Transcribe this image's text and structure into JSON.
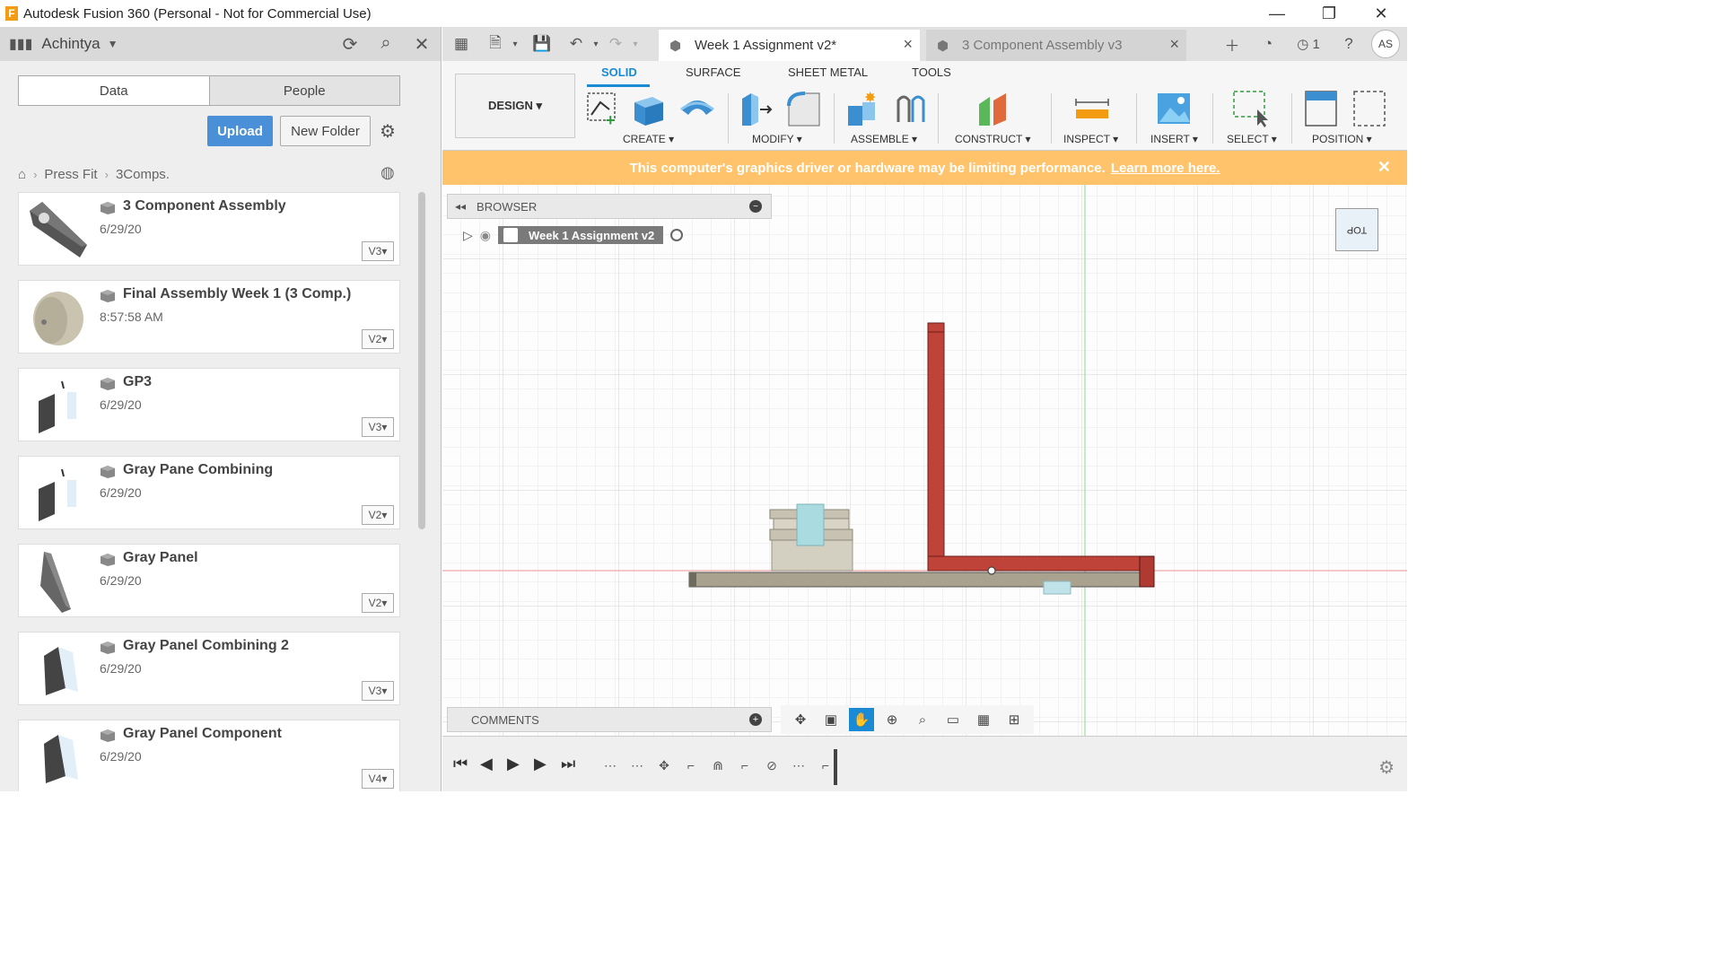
{
  "window": {
    "title": "Autodesk Fusion 360 (Personal - Not for Commercial Use)",
    "app_icon": "F",
    "controls": [
      "—",
      "❐",
      "✕"
    ]
  },
  "left_panel": {
    "user": "Achintya",
    "tabs": {
      "data": "Data",
      "people": "People"
    },
    "upload_label": "Upload",
    "new_folder_label": "New Folder",
    "breadcrumb": [
      "Press Fit",
      "3Comps."
    ],
    "files": [
      {
        "name": "3 Component Assembly",
        "date": "6/29/20",
        "version": "V3"
      },
      {
        "name": "Final Assembly Week 1 (3 Comp.)",
        "date": "8:57:58 AM",
        "version": "V2"
      },
      {
        "name": "GP3",
        "date": "6/29/20",
        "version": "V3"
      },
      {
        "name": "Gray Pane Combining",
        "date": "6/29/20",
        "version": "V2"
      },
      {
        "name": "Gray Panel",
        "date": "6/29/20",
        "version": "V2"
      },
      {
        "name": "Gray Panel Combining 2",
        "date": "6/29/20",
        "version": "V3"
      },
      {
        "name": "Gray Panel Component",
        "date": "6/29/20",
        "version": "V4"
      }
    ]
  },
  "doc_tabs": [
    {
      "label": "Week 1 Assignment v2*",
      "active": true
    },
    {
      "label": "3 Component Assembly v3",
      "active": false
    }
  ],
  "top_right": {
    "jobs_count": "1",
    "avatar": "AS"
  },
  "ribbon": {
    "workspace": "DESIGN ▾",
    "tabs": [
      "SOLID",
      "SURFACE",
      "SHEET METAL",
      "TOOLS"
    ],
    "groups": [
      "CREATE ▾",
      "MODIFY ▾",
      "ASSEMBLE ▾",
      "CONSTRUCT ▾",
      "INSPECT ▾",
      "INSERT ▾",
      "SELECT ▾",
      "POSITION ▾"
    ]
  },
  "warning": {
    "text": "This computer's graphics driver or hardware may be limiting performance.",
    "link": "Learn more here."
  },
  "browser": {
    "title": "BROWSER",
    "root_item": "Week 1 Assignment v2"
  },
  "viewcube": {
    "label": "TOP"
  },
  "comments": {
    "title": "COMMENTS"
  },
  "colors": {
    "accent": "#1a8ad4",
    "upload": "#4a90d9",
    "warning": "#ffc36b",
    "part_red": "#c0433a",
    "part_tan": "#a8a28f"
  }
}
